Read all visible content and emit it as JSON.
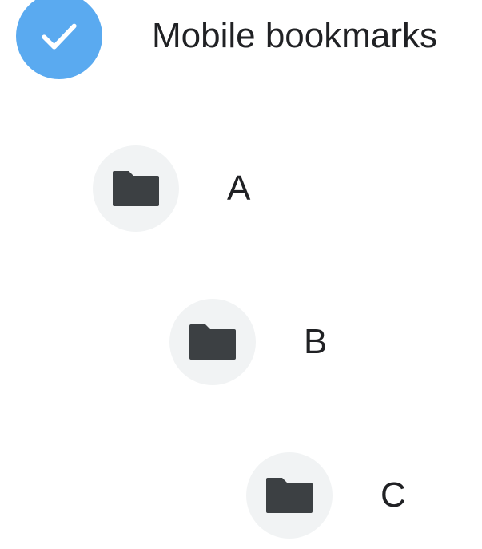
{
  "root": {
    "label": "Mobile bookmarks",
    "icon": "check-icon",
    "selected": true,
    "accent_color": "#5aaaf0"
  },
  "folders": [
    {
      "label": "A",
      "icon": "folder-icon"
    },
    {
      "label": "B",
      "icon": "folder-icon"
    },
    {
      "label": "C",
      "icon": "folder-icon"
    }
  ],
  "colors": {
    "folder_circle": "#f1f3f4",
    "folder_icon": "#3c4043",
    "text": "#202124"
  }
}
